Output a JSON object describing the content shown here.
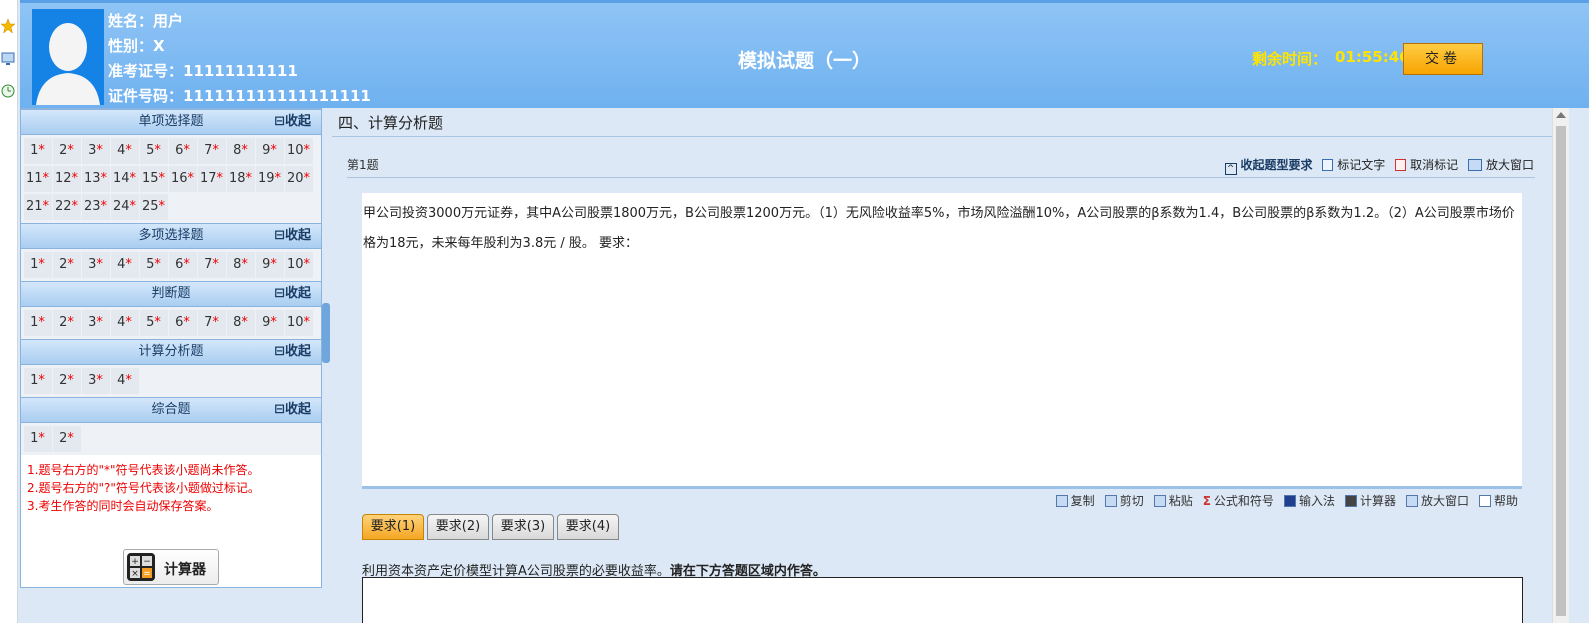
{
  "user": {
    "name_line": "姓名：用户",
    "gender_line": "性别：X",
    "ticket_line": "准考证号：11111111111",
    "id_line": "证件号码：111111111111111111"
  },
  "exam": {
    "title": "模拟试题（一）",
    "timer_label": "剩余时间：",
    "timer_value": "01:55:46",
    "submit_label": "交卷"
  },
  "sidebar": {
    "collapse_label": "⊟收起",
    "sections": [
      {
        "title": "单项选择题",
        "count": 25
      },
      {
        "title": "多项选择题",
        "count": 10
      },
      {
        "title": "判断题",
        "count": 10
      },
      {
        "title": "计算分析题",
        "count": 4
      },
      {
        "title": "综合题",
        "count": 2
      }
    ],
    "unanswered_mark": "*",
    "notes": [
      "1.题号右方的\"*\"符号代表该小题尚未作答。",
      "2.题号右方的\"?\"符号代表该小题做过标记。",
      "3.考生作答的同时会自动保存答案。"
    ],
    "calculator_label": "计算器"
  },
  "main": {
    "section_title": "四、计算分析题",
    "question_number": "第1题",
    "tools": {
      "collapse_req": "收起题型要求",
      "mark_text": "标记文字",
      "unmark": "取消标记",
      "enlarge": "放大窗口"
    },
    "question_text": "甲公司投资3000万元证券，其中A公司股票1800万元，B公司股票1200万元。（1）无风险收益率5%，市场风险溢酬10%，A公司股票的β系数为1.4，B公司股票的β系数为1.2。（2）A公司股票市场价格为18元，未来每年股利为3.8元 / 股。 要求：",
    "edit_tools": {
      "copy": "复制",
      "cut": "剪切",
      "paste": "粘贴",
      "formula": "公式和符号",
      "ime": "输入法",
      "calculator": "计算器",
      "enlarge": "放大窗口",
      "help": "帮助"
    },
    "tabs": [
      "要求(1)",
      "要求(2)",
      "要求(3)",
      "要求(4)"
    ],
    "active_tab": 0,
    "requirement_text": "利用资本资产定价模型计算A公司股票的必要收益率。",
    "requirement_instruction": "请在下方答题区域内作答。"
  },
  "colors": {
    "header_blue": "#7ab8f2",
    "timer_yellow": "#ffe400",
    "submit_orange": "#f7a400",
    "unanswered_red": "#ee0000"
  }
}
